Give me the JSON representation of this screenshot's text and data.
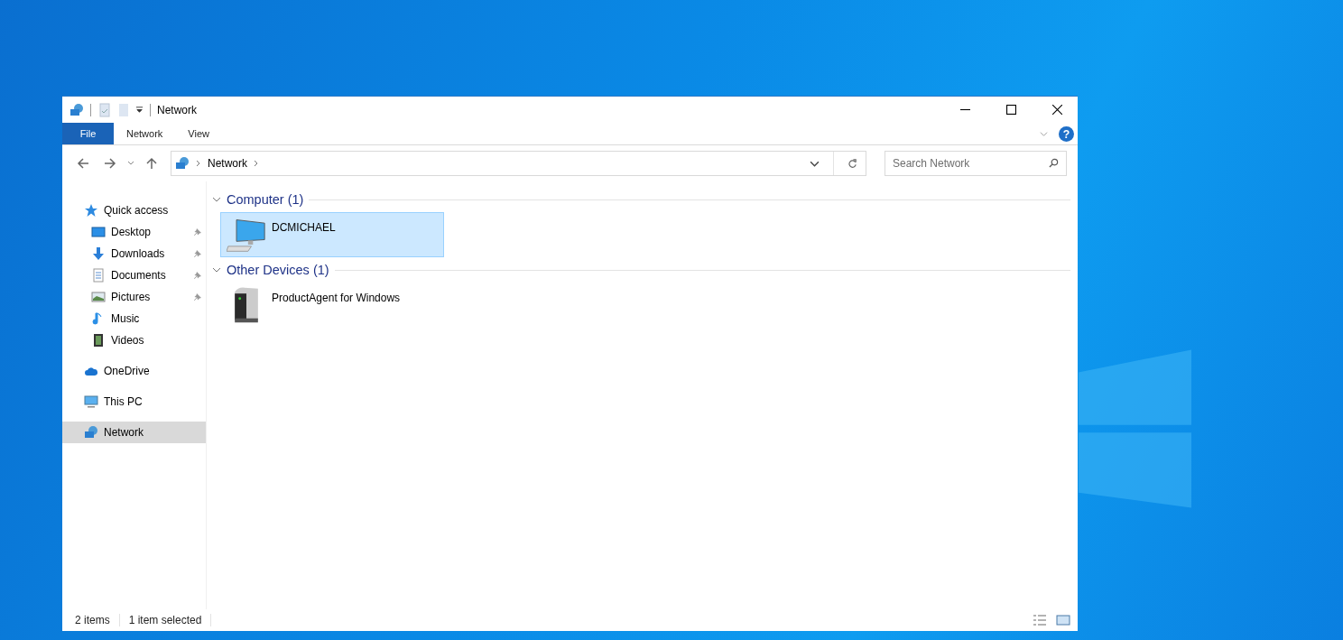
{
  "window": {
    "title": "Network"
  },
  "ribbon": {
    "tabs": [
      {
        "label": "File",
        "selected": true
      },
      {
        "label": "Network",
        "selected": false
      },
      {
        "label": "View",
        "selected": false
      }
    ],
    "help": "?"
  },
  "address": {
    "crumbs": [
      "Network"
    ]
  },
  "search": {
    "placeholder": "Search Network"
  },
  "sidebar": {
    "items": [
      {
        "label": "Quick access",
        "kind": "star",
        "selected": false,
        "children": [
          {
            "label": "Desktop",
            "kind": "desktop",
            "pinned": true,
            "selected": false
          },
          {
            "label": "Downloads",
            "kind": "download",
            "pinned": true,
            "selected": false
          },
          {
            "label": "Documents",
            "kind": "document",
            "pinned": true,
            "selected": false
          },
          {
            "label": "Pictures",
            "kind": "picture",
            "pinned": true,
            "selected": false
          },
          {
            "label": "Music",
            "kind": "music",
            "pinned": false,
            "selected": false
          },
          {
            "label": "Videos",
            "kind": "video",
            "pinned": false,
            "selected": false
          }
        ]
      },
      {
        "label": "OneDrive",
        "kind": "cloud",
        "selected": false
      },
      {
        "label": "This PC",
        "kind": "pc",
        "selected": false
      },
      {
        "label": "Network",
        "kind": "network",
        "selected": true
      }
    ]
  },
  "groups": [
    {
      "title": "Computer (1)",
      "expanded": true,
      "items": [
        {
          "name": "DCMICHAEL",
          "kind": "computer",
          "selected": true
        }
      ]
    },
    {
      "title": "Other Devices (1)",
      "expanded": true,
      "items": [
        {
          "name": "ProductAgent for Windows",
          "kind": "device",
          "selected": false
        }
      ]
    }
  ],
  "status_bar": {
    "items_count": "2 items",
    "selection": "1 item selected"
  }
}
